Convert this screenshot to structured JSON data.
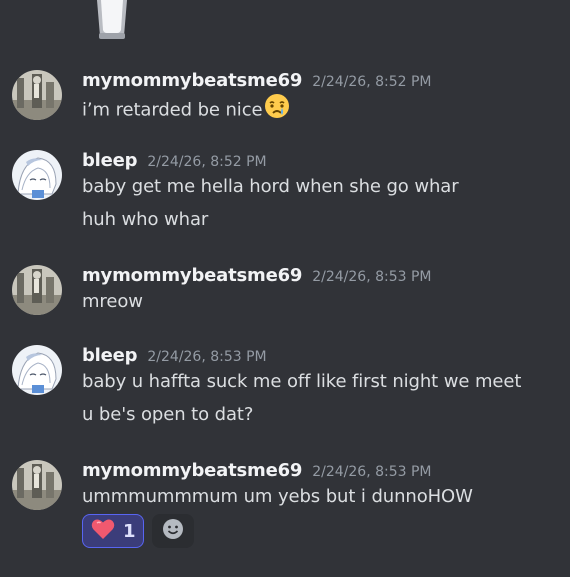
{
  "messages": [
    {
      "username": "mymommybeatsme69",
      "timestamp": "2/24/26, 8:52 PM",
      "lines": [
        "i’m retarded be nice"
      ],
      "emoji": "crying-face-icon"
    },
    {
      "username": "bleep",
      "timestamp": "2/24/26, 8:52 PM",
      "lines": [
        "baby get me hella hord when she go whar",
        "huh who whar"
      ]
    },
    {
      "username": "mymommybeatsme69",
      "timestamp": "2/24/26, 8:53 PM",
      "lines": [
        "mreow"
      ]
    },
    {
      "username": "bleep",
      "timestamp": "2/24/26, 8:53 PM",
      "lines": [
        "baby u haffta suck me off like first night we meet",
        "u be's open to dat?"
      ]
    },
    {
      "username": "mymommybeatsme69",
      "timestamp": "2/24/26, 8:53 PM",
      "lines": [
        "ummmummmum um yebs but i dunnoHOW"
      ],
      "reaction": {
        "icon": "heart-icon",
        "count": "1"
      }
    }
  ],
  "colors": {
    "background": "#313338",
    "username": "#f2f3f5",
    "timestamp": "#949ba4",
    "text": "#dbdee1",
    "reaction_bg": "#3b3d7a",
    "reaction_border": "#5865f2"
  }
}
